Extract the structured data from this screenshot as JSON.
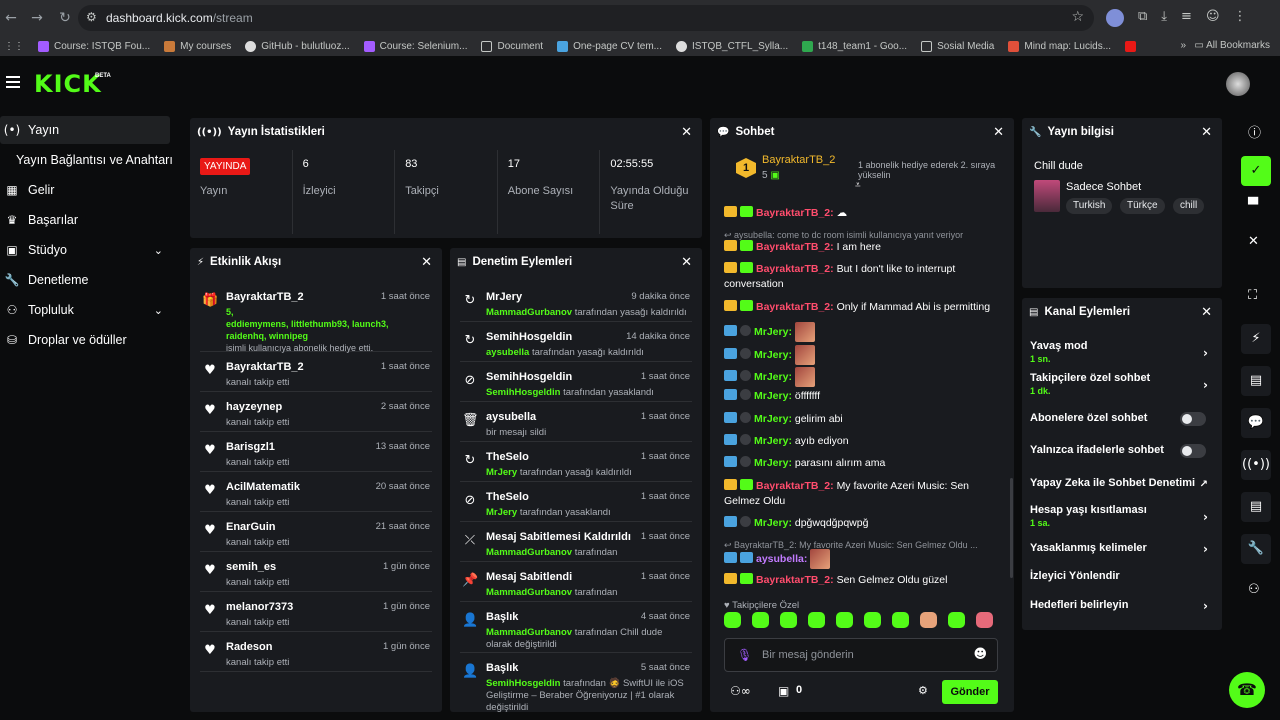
{
  "browser": {
    "url_host": "dashboard.kick.com",
    "url_path": "/stream",
    "bookmarks": [
      "Course: ISTQB Fou...",
      "My courses",
      "GitHub - bulutluoz...",
      "Course: Selenium...",
      "Document",
      "One-page CV tem...",
      "ISTQB_CTFL_Sylla...",
      "t148_team1 - Goo...",
      "Sosial Media",
      "Mind map: Lucids..."
    ],
    "all_bookmarks": "All Bookmarks"
  },
  "app": {
    "logo": "KICK",
    "beta": "BETA"
  },
  "sidebar": {
    "items": [
      {
        "label": "Yayın",
        "icon": "broadcast-icon"
      },
      {
        "label": "Yayın Bağlantısı ve Anahtarı",
        "icon": ""
      },
      {
        "label": "Gelir",
        "icon": "chart-icon"
      },
      {
        "label": "Başarılar",
        "icon": "trophy-icon"
      },
      {
        "label": "Stüdyo",
        "icon": "studio-icon"
      },
      {
        "label": "Denetleme",
        "icon": "wrench-icon"
      },
      {
        "label": "Topluluk",
        "icon": "community-icon"
      },
      {
        "label": "Droplar ve ödüller",
        "icon": "gift-icon"
      }
    ]
  },
  "stats": {
    "title": "Yayın İstatistikleri",
    "live_badge": "YAYINDA",
    "items": [
      {
        "value": "",
        "label": "Yayın"
      },
      {
        "value": "6",
        "label": "İzleyici"
      },
      {
        "value": "83",
        "label": "Takipçi"
      },
      {
        "value": "17",
        "label": "Abone Sayısı"
      },
      {
        "value": "02:55:55",
        "label": "Yayında Olduğu Süre"
      }
    ]
  },
  "activity": {
    "title": "Etkinlik Akışı",
    "gift": {
      "name": "BayraktarTB_2",
      "time": "1 saat önce",
      "count": "5,",
      "users1": "eddiemymens, littlethumb93, launch3,",
      "users2": "raidenhq, winnipeg",
      "text": "isimli kullanıcıya abonelik hediye etti."
    },
    "follows": [
      {
        "name": "BayraktarTB_2",
        "time": "1 saat önce",
        "text": "kanalı takip etti"
      },
      {
        "name": "hayzeynep",
        "time": "2 saat önce",
        "text": "kanalı takip etti"
      },
      {
        "name": "Barisgzl1",
        "time": "13 saat önce",
        "text": "kanalı takip etti"
      },
      {
        "name": "AcilMatematik",
        "time": "20 saat önce",
        "text": "kanalı takip etti"
      },
      {
        "name": "EnarGuin",
        "time": "21 saat önce",
        "text": "kanalı takip etti"
      },
      {
        "name": "semih_es",
        "time": "1 gün önce",
        "text": "kanalı takip etti"
      },
      {
        "name": "melanor7373",
        "time": "1 gün önce",
        "text": "kanalı takip etti"
      },
      {
        "name": "Radeson",
        "time": "1 gün önce",
        "text": "kanalı takip etti"
      }
    ]
  },
  "moderation": {
    "title": "Denetim Eylemleri",
    "items": [
      {
        "name": "MrJery",
        "time": "9 dakika önce",
        "user": "MammadGurbanov",
        "text": "tarafından yasağı kaldırıldı",
        "extra": ""
      },
      {
        "name": "SemihHosgeldin",
        "time": "14 dakika önce",
        "user": "aysubella",
        "text": "tarafından yasağı kaldırıldı",
        "extra": ""
      },
      {
        "name": "SemihHosgeldin",
        "time": "1 saat önce",
        "user": "SemihHosgeldin",
        "text": "tarafından yasaklandı",
        "extra": ""
      },
      {
        "name": "aysubella",
        "time": "1 saat önce",
        "user": "",
        "text": "bir mesajı sildi",
        "extra": ""
      },
      {
        "name": "TheSelo",
        "time": "1 saat önce",
        "user": "MrJery",
        "text": "tarafından yasağı kaldırıldı",
        "extra": ""
      },
      {
        "name": "TheSelo",
        "time": "1 saat önce",
        "user": "MrJery",
        "text": "tarafından yasaklandı",
        "extra": ""
      },
      {
        "name": "Mesaj Sabitlemesi Kaldırıldı",
        "time": "1 saat önce",
        "user": "MammadGurbanov",
        "text": "tarafından",
        "extra": ""
      },
      {
        "name": "Mesaj Sabitlendi",
        "time": "1 saat önce",
        "user": "MammadGurbanov",
        "text": "tarafından",
        "extra": ""
      },
      {
        "name": "Başlık",
        "time": "4 saat önce",
        "user": "MammadGurbanov",
        "text": "tarafından Chill dude",
        "extra": "olarak değiştirildi"
      },
      {
        "name": "Başlık",
        "time": "5 saat önce",
        "user": "SemihHosgeldin",
        "text": "tarafından 🧔 SwiftUI ile iOS",
        "extra": "Geliştirme – Beraber Öğreniyoruz | #1 olarak"
      }
    ],
    "last_extra": "değiştirildi"
  },
  "chat": {
    "title": "Sohbet",
    "top_gifter": {
      "rank": "1",
      "name": "BayraktarTB_2",
      "count": "5",
      "hint": "1 abonelik hediye ederek 2. sıraya yükselin"
    },
    "reply1": "aysubella: come to dc room isimli kullanıcıya yanıt veriyor",
    "reply2": "BayraktarTB_2: My favorite Azeri Music: Sen Gelmez Oldu ...",
    "messages": [
      {
        "user": "BayraktarTB_2",
        "text": ""
      },
      {
        "user": "BayraktarTB_2",
        "text": "I am here"
      },
      {
        "user": "BayraktarTB_2",
        "text": "But I don't like to interrupt conversation"
      },
      {
        "user": "BayraktarTB_2",
        "text": "Only if Mammad Abi is permitting"
      },
      {
        "user": "MrJery",
        "text": ""
      },
      {
        "user": "MrJery",
        "text": ""
      },
      {
        "user": "MrJery",
        "text": ""
      },
      {
        "user": "MrJery",
        "text": "öfffffff"
      },
      {
        "user": "MrJery",
        "text": "gelirim abi"
      },
      {
        "user": "MrJery",
        "text": "ayıb ediyon"
      },
      {
        "user": "MrJery",
        "text": "parasını alırım ama"
      },
      {
        "user": "BayraktarTB_2",
        "text": "My favorite Azeri Music: Sen Gelmez Oldu"
      },
      {
        "user": "MrJery",
        "text": "dpğwqdğpqwpğ"
      },
      {
        "user": "aysubella",
        "text": ""
      },
      {
        "user": "BayraktarTB_2",
        "text": "Sen Gelmez Oldu güzel"
      }
    ],
    "followers_only": "Takipçilere Özel",
    "input_placeholder": "Bir mesaj gönderin",
    "points": "0",
    "send": "Gönder"
  },
  "stream_info": {
    "title": "Yayın bilgisi",
    "stream_title": "Chill dude",
    "category": "Sadece Sohbet",
    "tags": [
      "Turkish",
      "Türkçe",
      "chill"
    ]
  },
  "channel_actions": {
    "title": "Kanal Eylemleri",
    "items": [
      {
        "label": "Yavaş mod",
        "sub": "1 sn.",
        "type": "chevron"
      },
      {
        "label": "Takipçilere özel sohbet",
        "sub": "1 dk.",
        "type": "chevron"
      },
      {
        "label": "Abonelere özel sohbet",
        "sub": "",
        "type": "toggle"
      },
      {
        "label": "Yalnızca ifadelerle sohbet",
        "sub": "",
        "type": "toggle"
      },
      {
        "label": "Yapay Zeka ile Sohbet Denetimi",
        "sub": "",
        "type": "external"
      },
      {
        "label": "Hesap yaşı kısıtlaması",
        "sub": "1 sa.",
        "type": "chevron"
      },
      {
        "label": "Yasaklanmış kelimeler",
        "sub": "",
        "type": "chevron"
      },
      {
        "label": "İzleyici Yönlendir",
        "sub": "",
        "type": "none"
      },
      {
        "label": "Hedefleri belirleyin",
        "sub": "",
        "type": "chevron"
      }
    ]
  },
  "colors": {
    "brand": "#53fc18",
    "live": "#e91916",
    "gold": "#f2b92c",
    "panel": "#191b1f"
  }
}
